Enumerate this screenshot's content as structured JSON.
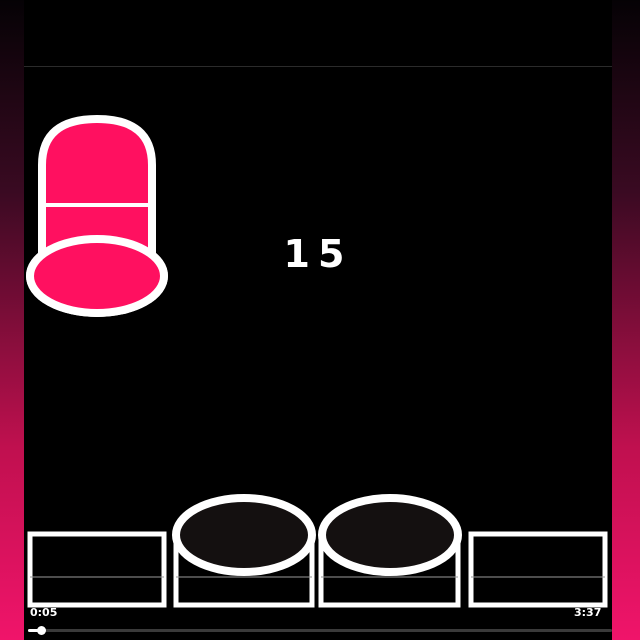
{
  "game": {
    "score": "15",
    "accent_color": "#ff1060",
    "outline_color": "#ffffff",
    "active_cup": "pink-cup",
    "cups_in_slots": 2,
    "slots": 4
  },
  "player": {
    "current_time": "0:05",
    "duration": "3:37",
    "progress_fraction": 0.023
  }
}
